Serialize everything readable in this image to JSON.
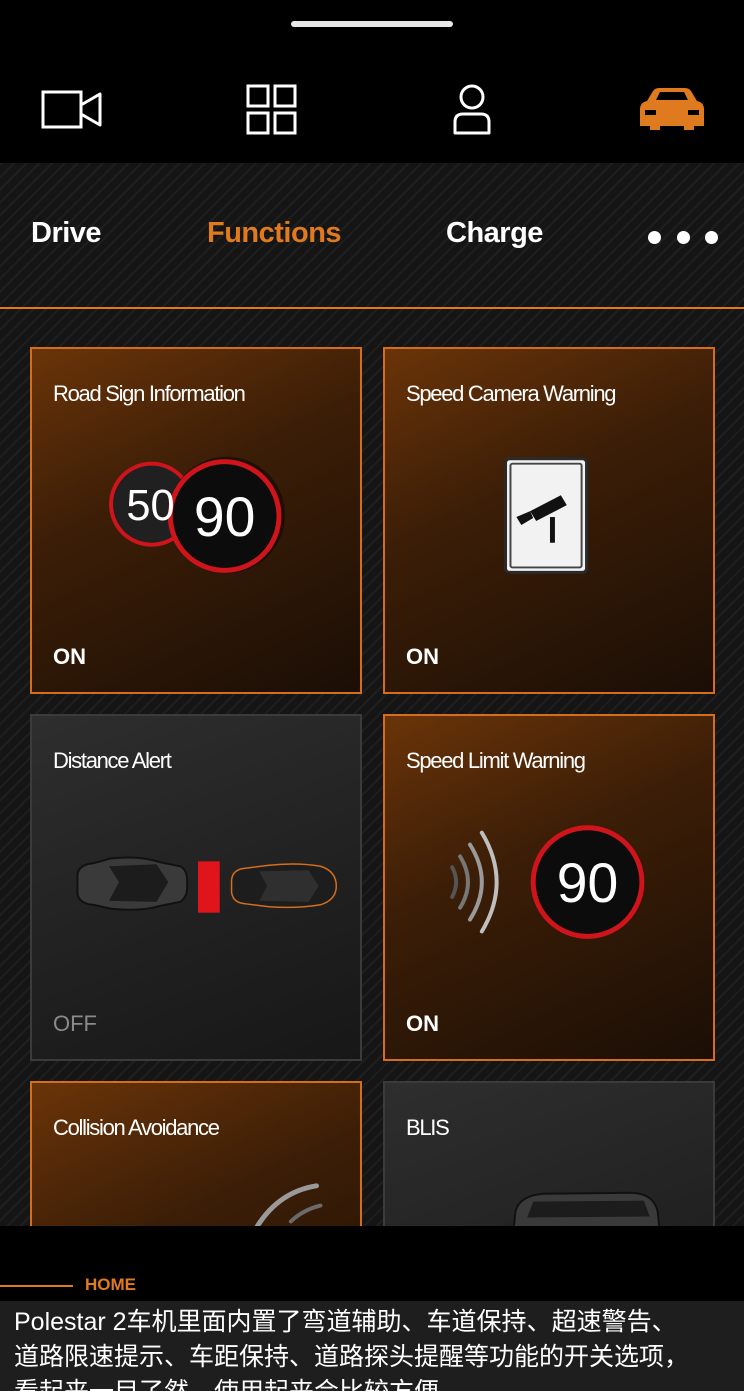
{
  "tabs": [
    {
      "label": "Drive"
    },
    {
      "label": "Functions"
    },
    {
      "label": "Charge"
    }
  ],
  "top_nav_icons": [
    "video-camera-icon",
    "grid-icon",
    "user-icon",
    "car-icon"
  ],
  "active_top_nav": "car-icon",
  "cards": [
    {
      "title": "Road Sign Information",
      "status": "ON",
      "sign_values": [
        "50",
        "90"
      ]
    },
    {
      "title": "Speed Camera Warning",
      "status": "ON"
    },
    {
      "title": "Distance Alert",
      "status": "OFF"
    },
    {
      "title": "Speed Limit Warning",
      "status": "ON",
      "sign_value": "90"
    },
    {
      "title": "Collision Avoidance"
    },
    {
      "title": "BLIS"
    }
  ],
  "bottom": {
    "home_label": "HOME"
  },
  "caption": {
    "lines": [
      "Polestar 2车机里面内置了弯道辅助、车道保持、超速警告、",
      "道路限速提示、车距保持、道路探头提醒等功能的开关选项，",
      "看起来一目了然，使用起来会比较方便。"
    ]
  },
  "colors": {
    "accent": "#e07a1f",
    "sign_red": "#d0141b",
    "background": "#000000"
  }
}
